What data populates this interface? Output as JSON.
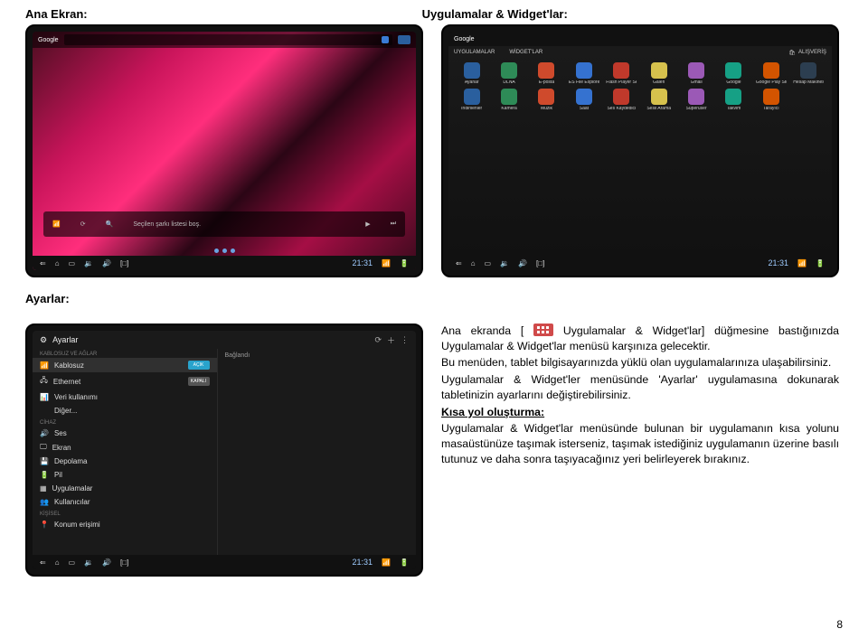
{
  "headings": {
    "home": "Ana Ekran:",
    "apps": "Uygulamalar & Widget'lar:",
    "settings": "Ayarlar:"
  },
  "home_screen": {
    "google_label": "Google",
    "music_empty": "Seçilen şarkı listesi boş.",
    "clock": "21:31"
  },
  "app_drawer": {
    "tabs": {
      "apps": "UYGULAMALAR",
      "widgets": "WİDGET'LAR"
    },
    "shop": "ALIŞVERİŞ",
    "clock": "21:31",
    "apps_row1": [
      "Ayarlar",
      "DLNA",
      "E-posta",
      "ES File Explorer",
      "Flash Player Se",
      "Galeri",
      "Gmail",
      "Google",
      "Google Play Stor",
      "Hesap Makinesi"
    ],
    "apps_row2": [
      "İndirilenler",
      "Kamera",
      "Müzik",
      "Saat",
      "Ses Kaydedici",
      "Sesli Arama",
      "Superuser",
      "Takvim",
      "Tarayıcı",
      ""
    ]
  },
  "settings_screen": {
    "title": "Ayarlar",
    "connected": "Bağlandı",
    "clock": "21:31",
    "cat_net": "KABLOSUZ VE AĞLAR",
    "cat_dev": "CİHAZ",
    "cat_pers": "KİŞİSEL",
    "items": {
      "wifi": "Kablosuz",
      "eth": "Ethernet",
      "data": "Veri kullanımı",
      "more": "Diğer...",
      "sound": "Ses",
      "display": "Ekran",
      "storage": "Depolama",
      "battery": "Pil",
      "apps": "Uygulamalar",
      "users": "Kullanıcılar",
      "location": "Konum erişimi"
    },
    "toggle_on": "AÇIK",
    "toggle_off": "KAPALI"
  },
  "body_text": {
    "p1a": "Ana ekranda [ ",
    "p1b": " Uygulamalar & Widget'lar] düğmesine bastığınızda Uygulamalar & Widget'lar menüsü karşınıza gelecektir.",
    "p2": "Bu menüden, tablet bilgisayarınızda yüklü olan uygulamalarınıza ulaşabilirsiniz.",
    "p3": "Uygulamalar & Widget'ler menüsünde 'Ayarlar' uygulamasına dokunarak tabletinizin ayarlarını değiştirebilirsiniz.",
    "p4_label": "Kısa yol oluşturma:",
    "p4": "Uygulamalar & Widget'lar menüsünde bulunan bir uygulamanın kısa yolunu masaüstünüze taşımak isterseniz, taşımak istediğiniz uygulamanın üzerine basılı tutunuz ve daha sonra taşıyacağınız yeri belirleyerek bırakınız."
  },
  "page_number": "8"
}
